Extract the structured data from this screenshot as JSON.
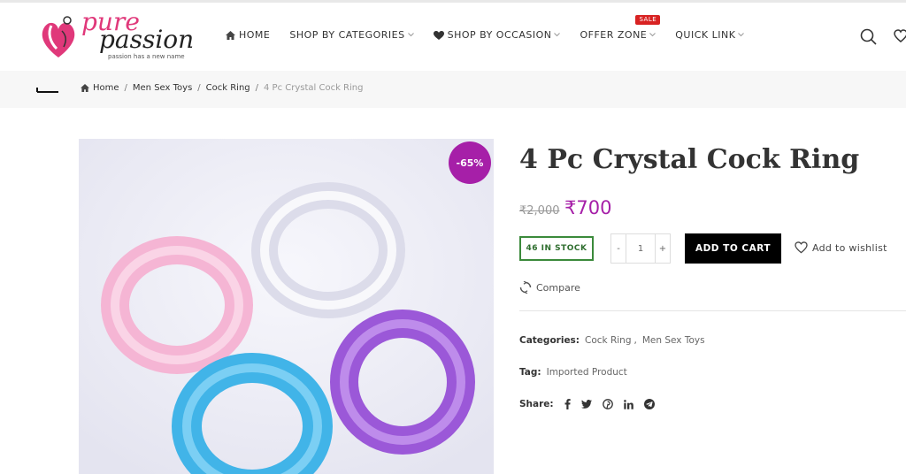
{
  "brand": {
    "name_line1": "pure",
    "name_line2": "passion",
    "tagline": "passion has a new name",
    "accent": "#e0387a"
  },
  "nav": {
    "items": [
      {
        "label": "HOME",
        "icon": "home-icon"
      },
      {
        "label": "SHOP BY CATEGORIES",
        "icon": "chevron-down-icon"
      },
      {
        "label": "SHOP BY OCCASION",
        "icon": "heart-icon"
      },
      {
        "label": "OFFER ZONE",
        "badge": "SALE"
      },
      {
        "label": "QUICK LINK",
        "icon": "chevron-down-icon"
      }
    ],
    "sale_badge_color": "#d82222"
  },
  "breadcrumb": {
    "items": [
      "Home",
      "Men Sex Toys",
      "Cock Ring",
      "4 Pc Crystal Cock Ring"
    ],
    "separator": "/"
  },
  "product": {
    "discount": "-65%",
    "discount_color": "#a61fa8",
    "title": "4 Pc Crystal Cock Ring",
    "price_old": "₹2,000",
    "price_new": "₹700",
    "stock": "46 IN STOCK",
    "quantity": "1",
    "qty_minus": "-",
    "qty_plus": "+",
    "add_to_cart": "ADD TO CART",
    "wishlist": "Add to wishlist",
    "compare": "Compare",
    "categories_label": "Categories:",
    "categories": [
      "Cock Ring",
      "Men Sex Toys"
    ],
    "category_sep": ",",
    "tag_label": "Tag:",
    "tag": "Imported Product",
    "share_label": "Share:",
    "share_icons": [
      "facebook-icon",
      "twitter-icon",
      "pinterest-icon",
      "linkedin-icon",
      "telegram-icon"
    ]
  }
}
